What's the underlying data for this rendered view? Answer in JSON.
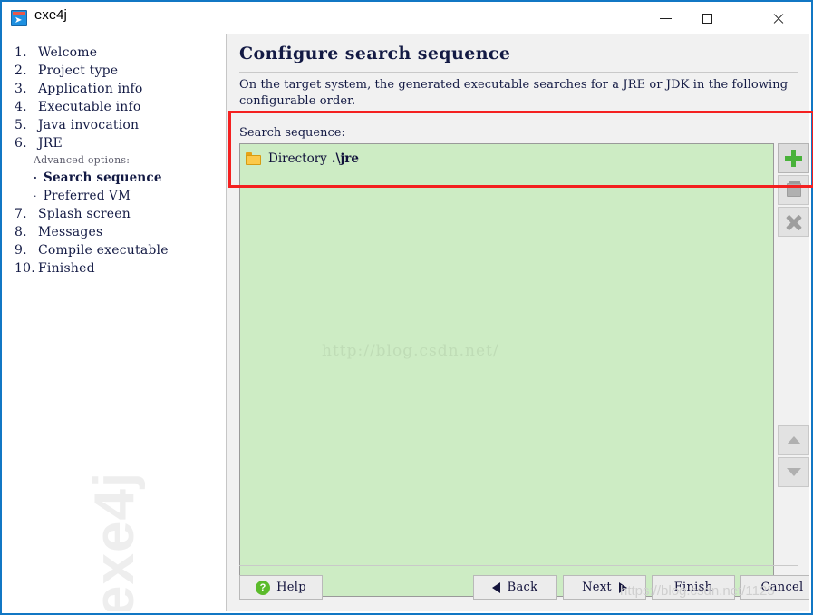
{
  "window": {
    "title": "exe4j",
    "icon": "exe4j-app-icon",
    "controls": {
      "minimize": "minimize-icon",
      "maximize": "maximize-icon",
      "close": "close-icon"
    }
  },
  "sidebar": {
    "steps": [
      {
        "num": "1.",
        "label": "Welcome"
      },
      {
        "num": "2.",
        "label": "Project type"
      },
      {
        "num": "3.",
        "label": "Application info"
      },
      {
        "num": "4.",
        "label": "Executable info"
      },
      {
        "num": "5.",
        "label": "Java invocation"
      },
      {
        "num": "6.",
        "label": "JRE"
      }
    ],
    "advanced_label": "Advanced options:",
    "substeps": [
      {
        "bullet": "·",
        "label": "Search sequence",
        "current": true
      },
      {
        "bullet": "·",
        "label": "Preferred VM",
        "current": false
      }
    ],
    "steps_after": [
      {
        "num": "7.",
        "label": "Splash screen"
      },
      {
        "num": "8.",
        "label": "Messages"
      },
      {
        "num": "9.",
        "label": "Compile executable"
      },
      {
        "num": "10.",
        "label": "Finished"
      }
    ],
    "watermark": "exe4j"
  },
  "main": {
    "title": "Configure search sequence",
    "description": "On the target system, the generated executable searches for a JRE or JDK in the following configurable order.",
    "field_label": "Search sequence:",
    "list": {
      "items": [
        {
          "icon": "folder-icon",
          "kind": "Directory",
          "path": ".\\jre"
        }
      ],
      "watermark": "http://blog.csdn.net/",
      "background_color": "#cdecc4"
    },
    "tools": [
      {
        "id": "add",
        "icon": "plus-icon",
        "enabled": true
      },
      {
        "id": "edit",
        "icon": "edit-icon",
        "enabled": false
      },
      {
        "id": "remove",
        "icon": "x-icon",
        "enabled": false
      },
      {
        "id": "move-up",
        "icon": "chevron-up-icon",
        "enabled": false
      },
      {
        "id": "move-down",
        "icon": "chevron-down-icon",
        "enabled": false
      }
    ]
  },
  "footer": {
    "help": "Help",
    "help_icon": "question-mark-icon",
    "back": "Back",
    "next": "Next",
    "finish": "Finish",
    "cancel": "Cancel",
    "watermark": "https://blog.csdn.net/1125"
  },
  "annotation": {
    "highlight_color": "#f42020"
  }
}
